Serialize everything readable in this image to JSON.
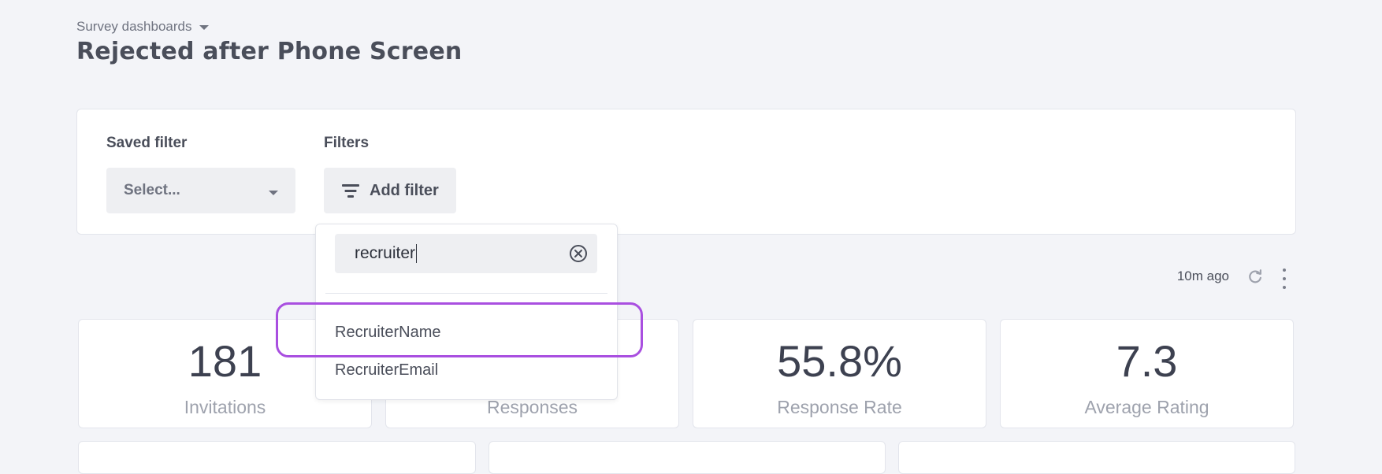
{
  "header": {
    "breadcrumb": "Survey dashboards",
    "title": "Rejected after Phone Screen"
  },
  "filters": {
    "saved_filter_label": "Saved filter",
    "saved_filter_placeholder": "Select...",
    "filters_label": "Filters",
    "add_filter_label": "Add filter"
  },
  "dropdown": {
    "search_value": "recruiter",
    "options": [
      "RecruiterName",
      "RecruiterEmail"
    ]
  },
  "status": {
    "updated": "10m ago"
  },
  "stats": [
    {
      "value": "181",
      "label": "Invitations"
    },
    {
      "value": "",
      "label": "Responses"
    },
    {
      "value": "55.8%",
      "label": "Response Rate"
    },
    {
      "value": "7.3",
      "label": "Average Rating"
    }
  ],
  "colors": {
    "background": "#f3f4f8",
    "highlight": "#a94fe0"
  }
}
